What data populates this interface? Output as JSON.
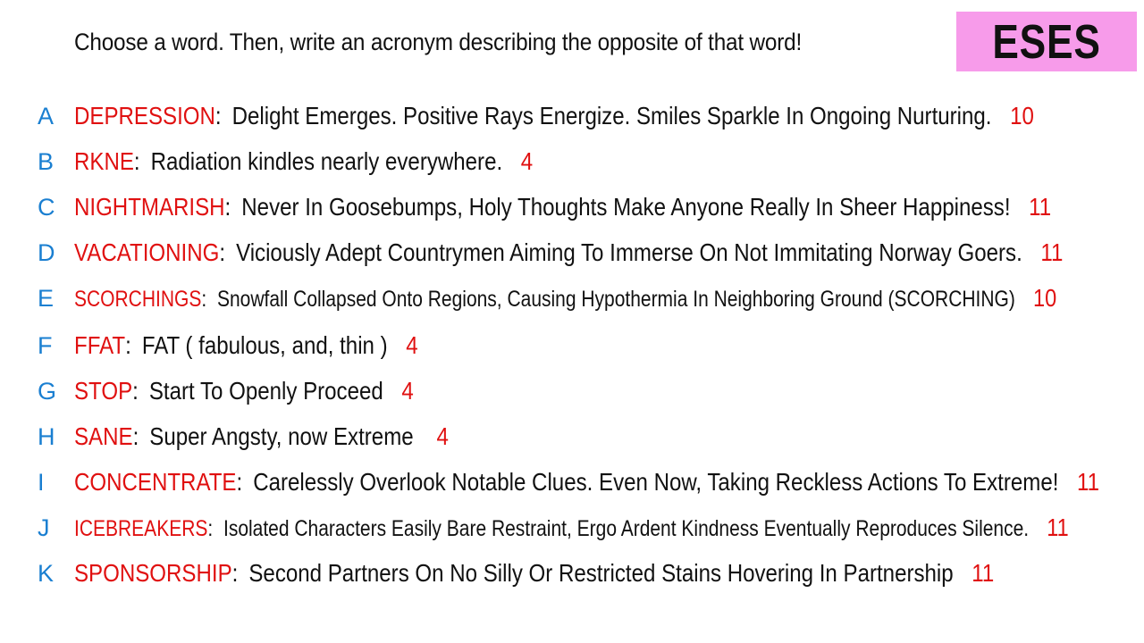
{
  "header": {
    "instruction": "Choose a word. Then, write an acronym describing the opposite of that word!",
    "badge": "ESES"
  },
  "rows": [
    {
      "letter": "A",
      "word": "DEPRESSION",
      "phrase": "Delight Emerges. Positive Rays Energize. Smiles Sparkle In Ongoing Nurturing.",
      "score": "10"
    },
    {
      "letter": "B",
      "word": "RKNE",
      "phrase": "Radiation kindles nearly everywhere.",
      "score": "4"
    },
    {
      "letter": "C",
      "word": "NIGHTMARISH",
      "phrase": "Never In Goosebumps, Holy Thoughts Make Anyone Really In Sheer Happiness!",
      "score": "11"
    },
    {
      "letter": "D",
      "word": "VACATIONING",
      "phrase": "Viciously Adept Countrymen Aiming To Immerse On Not Immitating Norway Goers.",
      "score": "11"
    },
    {
      "letter": "E",
      "word": "SCORCHINGS",
      "phrase": "Snowfall Collapsed Onto Regions, Causing Hypothermia In Neighboring Ground (SCORCHING)",
      "score": "10"
    },
    {
      "letter": "F",
      "word": "FFAT",
      "phrase": "FAT ( fabulous, and, thin )",
      "score": "4"
    },
    {
      "letter": "G",
      "word": "STOP",
      "phrase": "Start To Openly Proceed",
      "score": "4"
    },
    {
      "letter": "H",
      "word": "SANE",
      "phrase": "Super Angsty, now Extreme",
      "score": "4"
    },
    {
      "letter": "I",
      "word": "CONCENTRATE",
      "phrase": "Carelessly Overlook Notable Clues. Even Now, Taking Reckless Actions To Extreme!",
      "score": "11"
    },
    {
      "letter": "J",
      "word": "ICEBREAKERS",
      "phrase": "Isolated Characters Easily Bare Restraint, Ergo Ardent Kindness Eventually Reproduces Silence.",
      "score": "11"
    },
    {
      "letter": "K",
      "word": "SPONSORSHIP",
      "phrase": "Second Partners On No Silly Or Restricted Stains Hovering In Partnership",
      "score": "11"
    }
  ]
}
